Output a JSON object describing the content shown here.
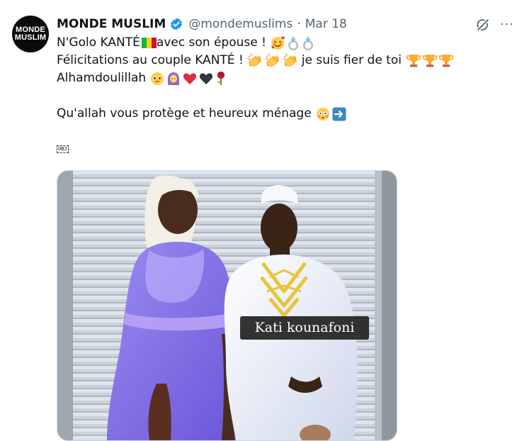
{
  "tweet": {
    "display_name": "MONDE MUSLIM",
    "handle": "@mondemuslims",
    "separator": "·",
    "date": "Mar 18",
    "more_label": "···",
    "avatar": {
      "line1": "MONDE",
      "line2": "MUSLIM"
    },
    "lines": [
      "N'Golo KANTÉ",
      "avec son épouse !",
      "Félicitations au couple KANTÉ !",
      "je suis fier de toi",
      "Alhamdoulillah",
      "Qu'allah vous protège et heureux ménage"
    ],
    "obj_label": "OBJ",
    "media_caption": "Kati kounafoni"
  },
  "icons": [
    "verified-badge-icon",
    "grok-icon",
    "more-icon",
    "mali-flag-icon",
    "smiling-hearts-icon",
    "ring-icon",
    "clapping-hands-icon",
    "trophy-icon",
    "pleading-face-icon",
    "woman-headscarf-icon",
    "red-heart-icon",
    "black-heart-icon",
    "rose-icon",
    "flushed-face-icon",
    "right-arrow-icon"
  ],
  "colors": {
    "verified": "#1d9bf0",
    "secondary_text": "#536471",
    "primary_text": "#0f1419"
  }
}
